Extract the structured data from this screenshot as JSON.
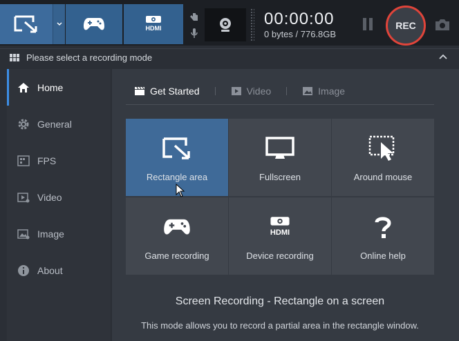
{
  "toolbar": {
    "modes": [
      {
        "name": "rectangle",
        "icon": "rectangle-select-icon"
      },
      {
        "name": "game",
        "icon": "gamepad-icon"
      },
      {
        "name": "device",
        "icon": "hdmi-icon"
      }
    ],
    "timer": "00:00:00",
    "storage": "0 bytes / 776.8GB",
    "rec_label": "REC"
  },
  "mode_bar": {
    "label": "Please select a recording mode"
  },
  "sidebar": {
    "items": [
      {
        "label": "Home",
        "icon": "home-icon",
        "active": true
      },
      {
        "label": "General",
        "icon": "gear-icon"
      },
      {
        "label": "FPS",
        "icon": "fps-icon"
      },
      {
        "label": "Video",
        "icon": "video-settings-icon"
      },
      {
        "label": "Image",
        "icon": "image-settings-icon"
      },
      {
        "label": "About",
        "icon": "info-icon"
      }
    ]
  },
  "tabs": [
    {
      "label": "Get Started",
      "icon": "clapperboard-icon",
      "active": true
    },
    {
      "label": "Video",
      "icon": "play-icon"
    },
    {
      "label": "Image",
      "icon": "picture-icon"
    }
  ],
  "tiles": [
    {
      "label": "Rectangle area",
      "icon": "rectangle-select-icon",
      "selected": true
    },
    {
      "label": "Fullscreen",
      "icon": "monitor-icon"
    },
    {
      "label": "Around mouse",
      "icon": "around-mouse-icon"
    },
    {
      "label": "Game recording",
      "icon": "gamepad-icon"
    },
    {
      "label": "Device recording",
      "icon": "hdmi-icon"
    },
    {
      "label": "Online help",
      "icon": "question-icon"
    }
  ],
  "description": {
    "title": "Screen Recording - Rectangle on a screen",
    "text": "This mode allows you to record a partial area in the rectangle window."
  },
  "colors": {
    "accent": "#3d6b9c",
    "rec_ring": "#e0443a",
    "active_indicator": "#3d8ee6"
  }
}
